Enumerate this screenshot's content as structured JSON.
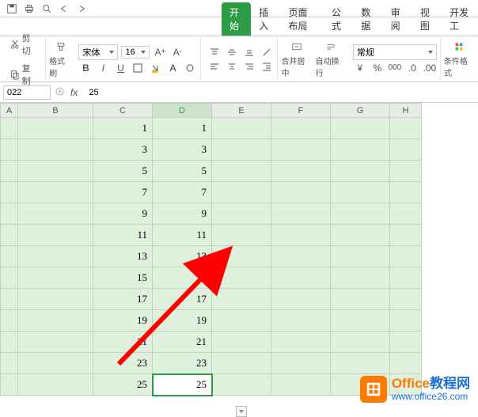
{
  "qat": {
    "items": [
      "save",
      "print",
      "preview",
      "undo",
      "redo"
    ]
  },
  "tabs": {
    "items": [
      "开始",
      "插入",
      "页面布局",
      "公式",
      "数据",
      "审阅",
      "视图",
      "开发工"
    ],
    "active": 0
  },
  "clipboard": {
    "cut": "剪切",
    "copy": "复制",
    "format_painter": "格式刷"
  },
  "font": {
    "name": "宋体",
    "size": "16"
  },
  "number_format": {
    "value": "常规"
  },
  "align": {
    "merge": "合并居中",
    "wrap": "自动换行"
  },
  "cond_format": "条件格式",
  "name_box": {
    "value": "022"
  },
  "formula": {
    "fx": "fx",
    "value": "25"
  },
  "columns": [
    "A",
    "B",
    "C",
    "D",
    "E",
    "F",
    "G",
    "H"
  ],
  "active_col": 3,
  "selected": {
    "row": 12,
    "col": 3
  },
  "chart_data": {
    "type": "table",
    "columns": [
      "C",
      "D"
    ],
    "rows": [
      {
        "C": 1,
        "D": 1
      },
      {
        "C": 3,
        "D": 3
      },
      {
        "C": 5,
        "D": 5
      },
      {
        "C": 7,
        "D": 7
      },
      {
        "C": 9,
        "D": 9
      },
      {
        "C": 11,
        "D": 11
      },
      {
        "C": 13,
        "D": 13
      },
      {
        "C": 15,
        "D": 15
      },
      {
        "C": 17,
        "D": 17
      },
      {
        "C": 19,
        "D": 19
      },
      {
        "C": 21,
        "D": 21
      },
      {
        "C": 23,
        "D": 23
      },
      {
        "C": 25,
        "D": 25
      }
    ]
  },
  "watermark": {
    "brand_a": "Office",
    "brand_b": "教程网",
    "url": "www.office26.com"
  }
}
